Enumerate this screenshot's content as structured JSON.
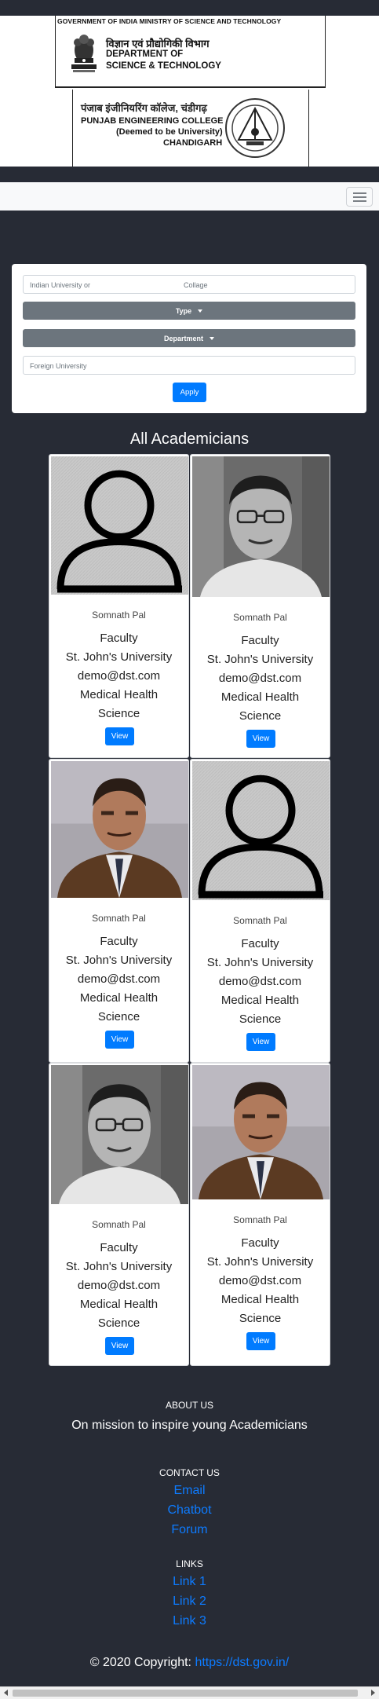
{
  "header": {
    "dst_line": "GOVERNMENT OF INDIA   MINISTRY OF SCIENCE AND TECHNOLOGY",
    "dst_hindi": "विज्ञान एवं प्रौद्योगिकी विभाग",
    "dst_eng_1": "DEPARTMENT OF",
    "dst_eng_2": "SCIENCE & TECHNOLOGY",
    "pec_hindi": "पंजाब इंजीनियरिंग कॉलेज, चंडीगढ़",
    "pec_line_1": "PUNJAB ENGINEERING COLLEGE",
    "pec_line_2": "(Deemed to be University)",
    "pec_line_3": "CHANDIGARH"
  },
  "navbar": {
    "toggler_icon": "hamburger-icon"
  },
  "filters": {
    "university_placeholder_a": "Indian University or",
    "university_placeholder_b": "Collage",
    "type_label": "Type",
    "department_label": "Department",
    "foreign_placeholder": "Foreign University",
    "apply_label": "Apply"
  },
  "academicians": {
    "title": "All Academicians",
    "cards": [
      {
        "photo": "placeholder-avatar",
        "name": "Somnath Pal",
        "role": "Faculty",
        "university": "St. John's University",
        "email": "demo@dst.com",
        "dept_1": "Medical Health",
        "dept_2": "Science",
        "button": "View"
      },
      {
        "photo": "man-glasses-bw",
        "name": "Somnath Pal",
        "role": "Faculty",
        "university": "St. John's University",
        "email": "demo@dst.com",
        "dept_1": "Medical Health",
        "dept_2": "Science",
        "button": "View"
      },
      {
        "photo": "man-brown-suit",
        "name": "Somnath Pal",
        "role": "Faculty",
        "university": "St. John's University",
        "email": "demo@dst.com",
        "dept_1": "Medical Health",
        "dept_2": "Science",
        "button": "View"
      },
      {
        "photo": "placeholder-avatar",
        "name": "Somnath Pal",
        "role": "Faculty",
        "university": "St. John's University",
        "email": "demo@dst.com",
        "dept_1": "Medical Health",
        "dept_2": "Science",
        "button": "View"
      },
      {
        "photo": "man-glasses-bw",
        "name": "Somnath Pal",
        "role": "Faculty",
        "university": "St. John's University",
        "email": "demo@dst.com",
        "dept_1": "Medical Health",
        "dept_2": "Science",
        "button": "View"
      },
      {
        "photo": "man-brown-suit",
        "name": "Somnath Pal",
        "role": "Faculty",
        "university": "St. John's University",
        "email": "demo@dst.com",
        "dept_1": "Medical Health",
        "dept_2": "Science",
        "button": "View"
      }
    ]
  },
  "footer": {
    "about_heading": "ABOUT US",
    "about_text": "On mission to inspire young Academicians",
    "contact_heading": "CONTACT US",
    "contact_links": [
      "Email",
      "Chatbot",
      "Forum"
    ],
    "links_heading": "LINKS",
    "links": [
      "Link 1",
      "Link 2",
      "Link 3"
    ],
    "copyright_text": "© 2020 Copyright:",
    "copyright_link": "https://dst.gov.in/"
  },
  "colors": {
    "page_bg": "#272b35",
    "primary": "#007bff",
    "secondary": "#6c757d",
    "link": "#0d7bff"
  }
}
